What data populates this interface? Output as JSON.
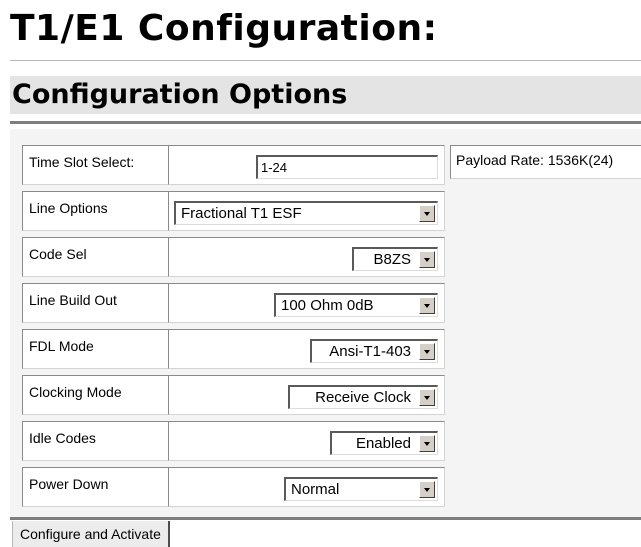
{
  "page": {
    "title": "T1/E1 Configuration:",
    "section_title": "Configuration Options"
  },
  "form": {
    "time_slot": {
      "label": "Time Slot Select:",
      "value": "1-24"
    },
    "payload_rate": "Payload Rate: 1536K(24)",
    "line_options": {
      "label": "Line Options",
      "value": "Fractional T1 ESF"
    },
    "code_sel": {
      "label": "Code Sel",
      "value": "B8ZS"
    },
    "line_build_out": {
      "label": "Line Build Out",
      "value": "100 Ohm 0dB"
    },
    "fdl_mode": {
      "label": "FDL Mode",
      "value": "Ansi-T1-403"
    },
    "clocking_mode": {
      "label": "Clocking Mode",
      "value": "Receive Clock"
    },
    "idle_codes": {
      "label": "Idle Codes",
      "value": "Enabled"
    },
    "power_down": {
      "label": "Power Down",
      "value": "Normal"
    }
  },
  "actions": {
    "configure_label": "Configure and Activate"
  },
  "icons": {
    "dropdown": "chevron-down-icon"
  }
}
